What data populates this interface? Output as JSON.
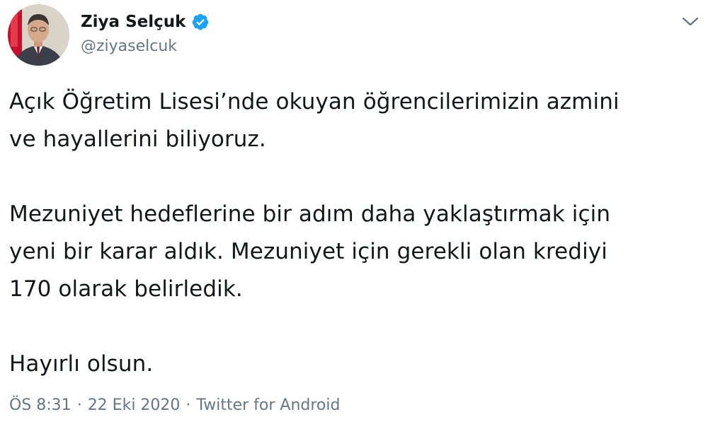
{
  "author": {
    "display_name": "Ziya Selçuk",
    "handle": "@ziyaselcuk",
    "verified": true
  },
  "tweet": {
    "paragraphs": [
      "Açık Öğretim Lisesi’nde okuyan öğrencilerimizin azmini\nve hayallerini biliyoruz.",
      "Mezuniyet hedeflerine bir adım daha yaklaştırmak için\nyeni bir karar aldık. Mezuniyet için gerekli olan krediyi\n170 olarak belirledik.",
      "Hayırlı olsun."
    ],
    "time": "ÖS 8:31",
    "separator": "·",
    "date": "22 Eki 2020",
    "source": "Twitter for Android"
  },
  "icons": {
    "verified": "verified-badge-icon",
    "menu": "chevron-down-icon",
    "avatar": "profile-photo"
  },
  "colors": {
    "verified_blue": "#1da1f2",
    "secondary_text": "#657786",
    "primary_text": "#14171a"
  }
}
